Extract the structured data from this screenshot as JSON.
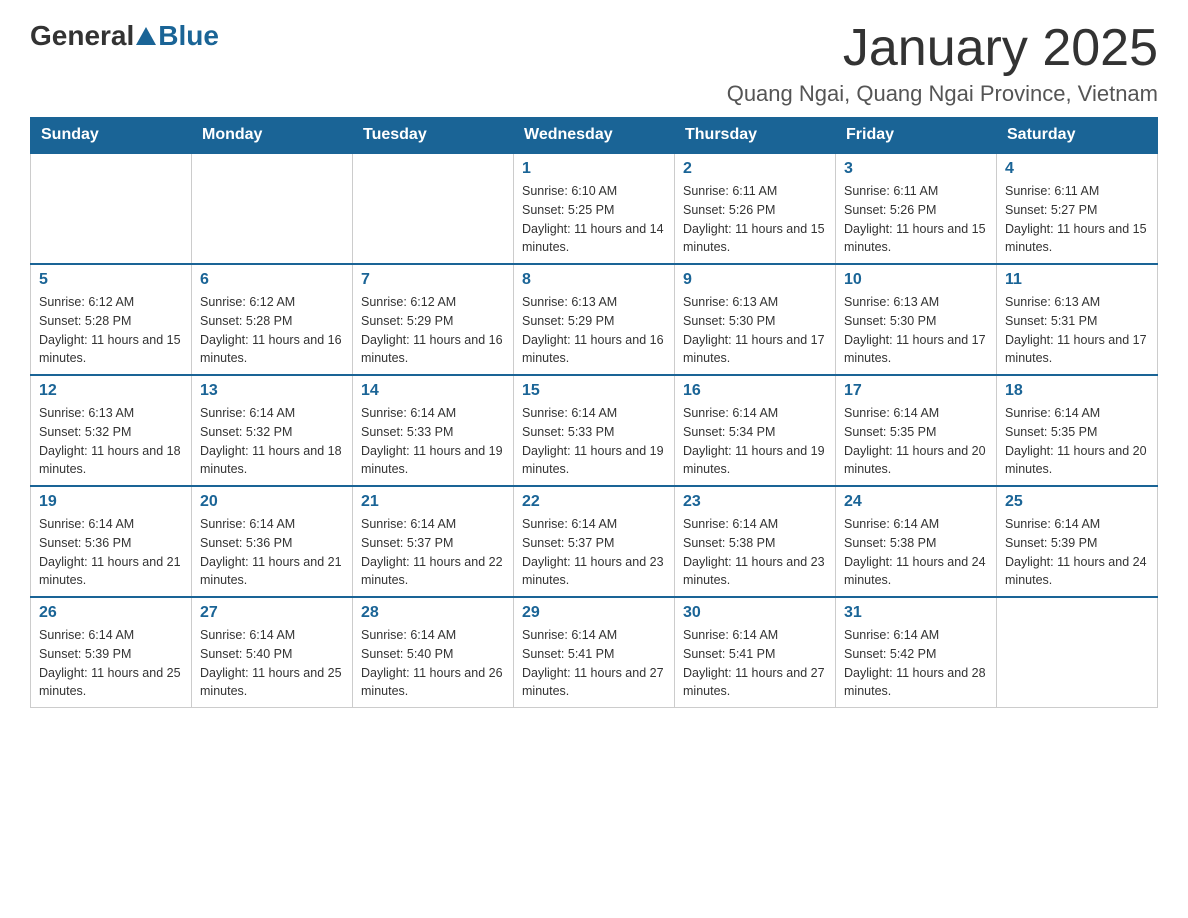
{
  "header": {
    "logo_general": "General",
    "logo_blue": "Blue",
    "month_title": "January 2025",
    "location": "Quang Ngai, Quang Ngai Province, Vietnam"
  },
  "days_of_week": [
    "Sunday",
    "Monday",
    "Tuesday",
    "Wednesday",
    "Thursday",
    "Friday",
    "Saturday"
  ],
  "weeks": [
    [
      {
        "day": "",
        "info": ""
      },
      {
        "day": "",
        "info": ""
      },
      {
        "day": "",
        "info": ""
      },
      {
        "day": "1",
        "info": "Sunrise: 6:10 AM\nSunset: 5:25 PM\nDaylight: 11 hours and 14 minutes."
      },
      {
        "day": "2",
        "info": "Sunrise: 6:11 AM\nSunset: 5:26 PM\nDaylight: 11 hours and 15 minutes."
      },
      {
        "day": "3",
        "info": "Sunrise: 6:11 AM\nSunset: 5:26 PM\nDaylight: 11 hours and 15 minutes."
      },
      {
        "day": "4",
        "info": "Sunrise: 6:11 AM\nSunset: 5:27 PM\nDaylight: 11 hours and 15 minutes."
      }
    ],
    [
      {
        "day": "5",
        "info": "Sunrise: 6:12 AM\nSunset: 5:28 PM\nDaylight: 11 hours and 15 minutes."
      },
      {
        "day": "6",
        "info": "Sunrise: 6:12 AM\nSunset: 5:28 PM\nDaylight: 11 hours and 16 minutes."
      },
      {
        "day": "7",
        "info": "Sunrise: 6:12 AM\nSunset: 5:29 PM\nDaylight: 11 hours and 16 minutes."
      },
      {
        "day": "8",
        "info": "Sunrise: 6:13 AM\nSunset: 5:29 PM\nDaylight: 11 hours and 16 minutes."
      },
      {
        "day": "9",
        "info": "Sunrise: 6:13 AM\nSunset: 5:30 PM\nDaylight: 11 hours and 17 minutes."
      },
      {
        "day": "10",
        "info": "Sunrise: 6:13 AM\nSunset: 5:30 PM\nDaylight: 11 hours and 17 minutes."
      },
      {
        "day": "11",
        "info": "Sunrise: 6:13 AM\nSunset: 5:31 PM\nDaylight: 11 hours and 17 minutes."
      }
    ],
    [
      {
        "day": "12",
        "info": "Sunrise: 6:13 AM\nSunset: 5:32 PM\nDaylight: 11 hours and 18 minutes."
      },
      {
        "day": "13",
        "info": "Sunrise: 6:14 AM\nSunset: 5:32 PM\nDaylight: 11 hours and 18 minutes."
      },
      {
        "day": "14",
        "info": "Sunrise: 6:14 AM\nSunset: 5:33 PM\nDaylight: 11 hours and 19 minutes."
      },
      {
        "day": "15",
        "info": "Sunrise: 6:14 AM\nSunset: 5:33 PM\nDaylight: 11 hours and 19 minutes."
      },
      {
        "day": "16",
        "info": "Sunrise: 6:14 AM\nSunset: 5:34 PM\nDaylight: 11 hours and 19 minutes."
      },
      {
        "day": "17",
        "info": "Sunrise: 6:14 AM\nSunset: 5:35 PM\nDaylight: 11 hours and 20 minutes."
      },
      {
        "day": "18",
        "info": "Sunrise: 6:14 AM\nSunset: 5:35 PM\nDaylight: 11 hours and 20 minutes."
      }
    ],
    [
      {
        "day": "19",
        "info": "Sunrise: 6:14 AM\nSunset: 5:36 PM\nDaylight: 11 hours and 21 minutes."
      },
      {
        "day": "20",
        "info": "Sunrise: 6:14 AM\nSunset: 5:36 PM\nDaylight: 11 hours and 21 minutes."
      },
      {
        "day": "21",
        "info": "Sunrise: 6:14 AM\nSunset: 5:37 PM\nDaylight: 11 hours and 22 minutes."
      },
      {
        "day": "22",
        "info": "Sunrise: 6:14 AM\nSunset: 5:37 PM\nDaylight: 11 hours and 23 minutes."
      },
      {
        "day": "23",
        "info": "Sunrise: 6:14 AM\nSunset: 5:38 PM\nDaylight: 11 hours and 23 minutes."
      },
      {
        "day": "24",
        "info": "Sunrise: 6:14 AM\nSunset: 5:38 PM\nDaylight: 11 hours and 24 minutes."
      },
      {
        "day": "25",
        "info": "Sunrise: 6:14 AM\nSunset: 5:39 PM\nDaylight: 11 hours and 24 minutes."
      }
    ],
    [
      {
        "day": "26",
        "info": "Sunrise: 6:14 AM\nSunset: 5:39 PM\nDaylight: 11 hours and 25 minutes."
      },
      {
        "day": "27",
        "info": "Sunrise: 6:14 AM\nSunset: 5:40 PM\nDaylight: 11 hours and 25 minutes."
      },
      {
        "day": "28",
        "info": "Sunrise: 6:14 AM\nSunset: 5:40 PM\nDaylight: 11 hours and 26 minutes."
      },
      {
        "day": "29",
        "info": "Sunrise: 6:14 AM\nSunset: 5:41 PM\nDaylight: 11 hours and 27 minutes."
      },
      {
        "day": "30",
        "info": "Sunrise: 6:14 AM\nSunset: 5:41 PM\nDaylight: 11 hours and 27 minutes."
      },
      {
        "day": "31",
        "info": "Sunrise: 6:14 AM\nSunset: 5:42 PM\nDaylight: 11 hours and 28 minutes."
      },
      {
        "day": "",
        "info": ""
      }
    ]
  ]
}
